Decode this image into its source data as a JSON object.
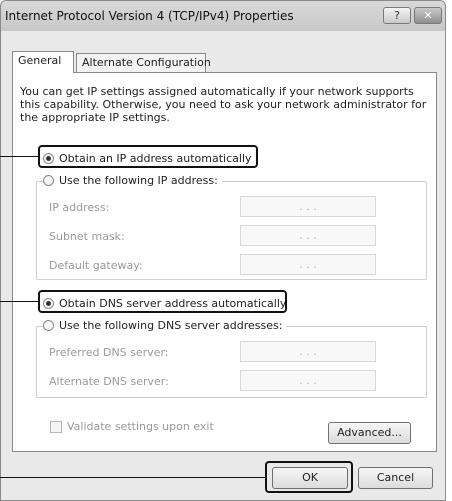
{
  "window": {
    "title": "Internet Protocol Version 4 (TCP/IPv4) Properties",
    "help_label": "?",
    "close_label": "✕"
  },
  "tabs": [
    {
      "label": "General",
      "active": true
    },
    {
      "label": "Alternate Configuration",
      "active": false
    }
  ],
  "description": "You can get IP settings assigned automatically if your network supports this capability. Otherwise, you need to ask your network administrator for the appropriate IP settings.",
  "ip": {
    "auto_option": {
      "label": "Obtain an IP address automatically",
      "selected": true
    },
    "manual_option": {
      "label": "Use the following IP address:",
      "selected": false
    },
    "fields": [
      {
        "label": "IP address:",
        "value": ". . ."
      },
      {
        "label": "Subnet mask:",
        "value": ". . ."
      },
      {
        "label": "Default gateway:",
        "value": ". . ."
      }
    ]
  },
  "dns": {
    "auto_option": {
      "label": "Obtain DNS server address automatically",
      "selected": true
    },
    "manual_option": {
      "label": "Use the following DNS server addresses:",
      "selected": false
    },
    "fields": [
      {
        "label": "Preferred DNS server:",
        "value": ". . ."
      },
      {
        "label": "Alternate DNS server:",
        "value": ". . ."
      }
    ]
  },
  "validate": {
    "label": "Validate settings upon exit",
    "checked": false
  },
  "buttons": {
    "advanced": "Advanced...",
    "ok": "OK",
    "cancel": "Cancel"
  },
  "colors": {
    "highlight_border": "#111111",
    "disabled_text": "#9a9a9a"
  }
}
